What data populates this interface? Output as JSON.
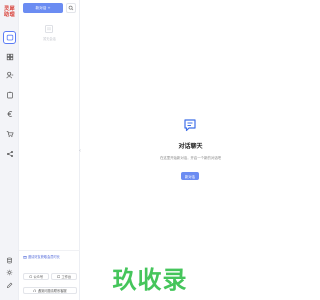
{
  "brand": {
    "logo_text_line1": "灵犀",
    "logo_text_line2": "助理"
  },
  "rail": {
    "items": [
      {
        "icon": "chat-bubble-icon",
        "active": true
      },
      {
        "icon": "grid-icon",
        "active": false
      },
      {
        "icon": "user-icon",
        "active": false
      },
      {
        "icon": "clipboard-icon",
        "active": false
      },
      {
        "icon": "euro-icon",
        "active": false
      },
      {
        "icon": "cart-icon",
        "active": false
      },
      {
        "icon": "share-icon",
        "active": false
      }
    ],
    "bottom": [
      {
        "icon": "database-icon"
      },
      {
        "icon": "settings-icon"
      },
      {
        "icon": "edit-icon"
      }
    ]
  },
  "sidebar": {
    "new_button_label": "新对话 +",
    "empty_text": "暂无会话",
    "invite_text": "邀请好友获取会员时长",
    "buttons": [
      {
        "label": "公众号"
      },
      {
        "label": "工作台"
      }
    ],
    "support_label": "遇到问题请联系客服"
  },
  "main": {
    "title": "对话聊天",
    "description": "在这里开始新对话，开启一个新的对话吧",
    "start_button_label": "新对话"
  },
  "watermark": "玖收录",
  "colors": {
    "accent": "#6b8cf2",
    "watermark": "#36c14e",
    "logo": "#d9423a"
  }
}
